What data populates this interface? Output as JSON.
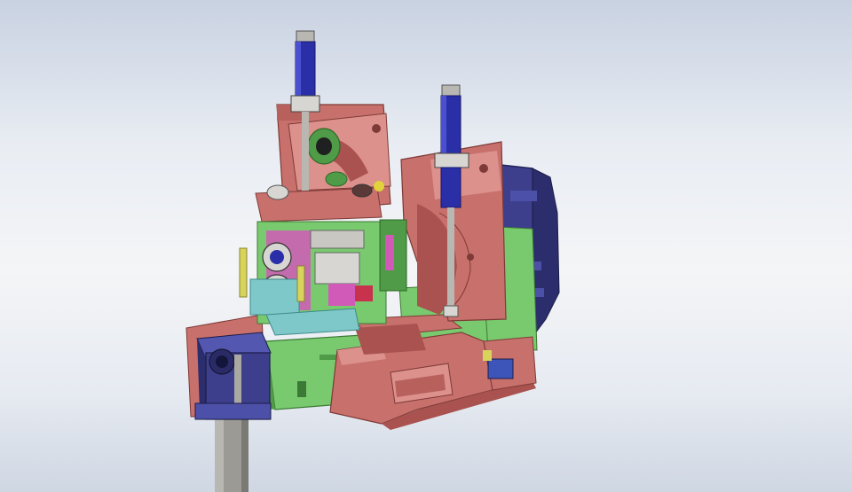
{
  "view": {
    "background_top": "#c9d2e2",
    "background_bottom": "#cfd7e3"
  },
  "colors": {
    "frame_red": "#c8706c",
    "frame_red_dark": "#a9524f",
    "frame_red_light": "#dc918c",
    "housing_green": "#79c96e",
    "housing_green_dark": "#4f9b47",
    "cylinder_blue": "#2a2fa8",
    "motor_navy": "#3d3f8c",
    "rod_gray": "#9c9a94",
    "cyan_plate": "#7fc8c9",
    "yellow_guide": "#d8d35a",
    "magenta_parts": "#d15ab8"
  },
  "parts": [
    "left-roll-stand",
    "right-roll-stand",
    "left-hydraulic-cylinder",
    "right-hydraulic-cylinder",
    "roll-cassette",
    "drive-motor",
    "support-column",
    "base-frame",
    "gear-housing"
  ]
}
